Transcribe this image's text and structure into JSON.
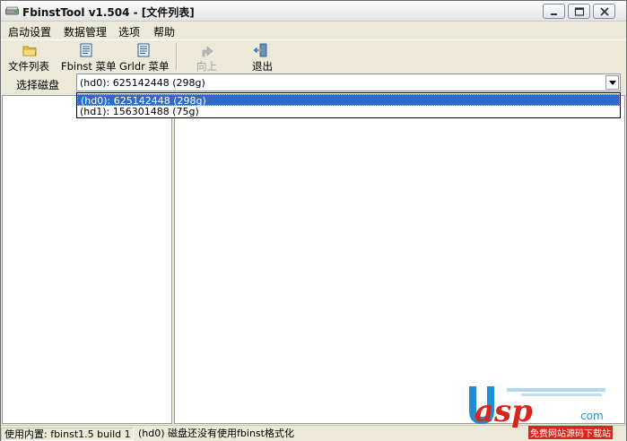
{
  "window": {
    "title": "FbinstTool v1.504 - [文件列表]"
  },
  "menubar": {
    "items": [
      {
        "label": "启动设置"
      },
      {
        "label": "数据管理"
      },
      {
        "label": "选项"
      },
      {
        "label": "帮助"
      }
    ]
  },
  "toolbar": {
    "buttons": [
      {
        "label": "文件列表",
        "icon": "folder-icon"
      },
      {
        "label": "Fbinst 菜单",
        "icon": "menu-doc-icon"
      },
      {
        "label": "Grldr 菜单",
        "icon": "menu-doc-icon"
      },
      {
        "label": "向上",
        "icon": "up-arrow-icon"
      },
      {
        "label": "退出",
        "icon": "exit-door-icon"
      }
    ]
  },
  "disk": {
    "label": "选择磁盘",
    "selected": "(hd0): 625142448 (298g)",
    "options": [
      "(hd0): 625142448 (298g)",
      "(hd1): 156301488 (75g)"
    ]
  },
  "statusbar": {
    "left": "使用内置: fbinst1.5 build 1",
    "right": "(hd0) 磁盘还没有使用fbinst格式化"
  },
  "watermark": {
    "text": "asp",
    "domain": "com",
    "subtitle": "免费网站源码下载站"
  },
  "colors": {
    "selection": "#316ac5",
    "chrome": "#ece9d8",
    "watermark_red": "#d9261c",
    "watermark_blue": "#1e8fd6"
  }
}
